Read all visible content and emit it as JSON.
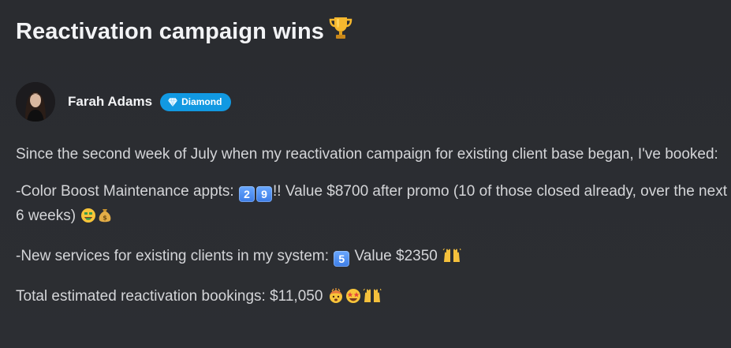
{
  "post": {
    "title": "Reactivation campaign wins",
    "title_emoji": "trophy-icon",
    "author": {
      "name": "Farah Adams",
      "badge": "Diamond",
      "badge_icon": "diamond-icon",
      "badge_color": "#1199e2"
    },
    "paragraph_1": {
      "text": "Since the second week of July when my reactivation campaign for existing client base began, I've booked:"
    },
    "paragraph_2": {
      "prefix": "-Color Boost Maintenance appts: ",
      "digit_1": "2",
      "digit_2": "9",
      "middle": "!! Value $8700 after promo (10 of those closed already, over the next 6 weeks) ",
      "emojis": [
        "money-mouth-face-icon",
        "money-bag-icon"
      ]
    },
    "paragraph_3": {
      "prefix": "-New services for existing clients in my system: ",
      "digit": "5",
      "middle": " Value $2350 ",
      "emojis": [
        "raising-hands-icon"
      ]
    },
    "paragraph_4": {
      "prefix": "Total estimated reactivation bookings:  $11,050 ",
      "emojis": [
        "exploding-head-icon",
        "star-struck-icon",
        "raising-hands-icon"
      ]
    }
  },
  "colors": {
    "background": "#2b2d31",
    "title": "#f2f3f5",
    "text": "#d4d5d8",
    "keycap": "#4a8cf0"
  }
}
